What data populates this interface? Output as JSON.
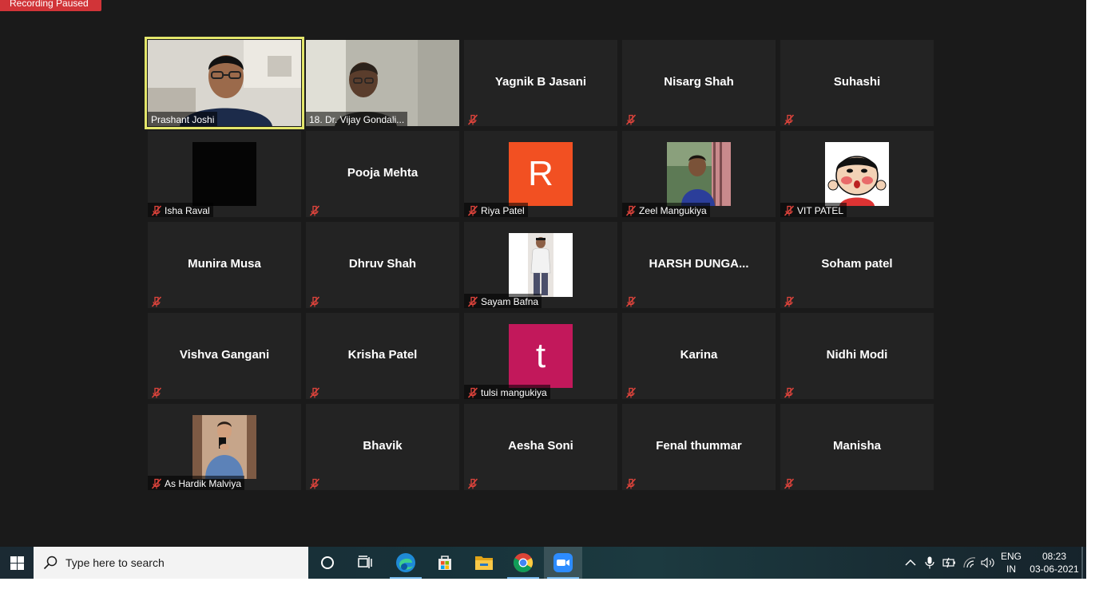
{
  "recording": {
    "label": "Recording Paused"
  },
  "participants": [
    {
      "name": "Prashant Joshi",
      "kind": "video",
      "active": true,
      "muted": false,
      "display": ""
    },
    {
      "name": "18. Dr. Vijay Gondali...",
      "kind": "video",
      "active": false,
      "muted": false,
      "display": ""
    },
    {
      "name": "Yagnik B Jasani",
      "kind": "name",
      "muted": true
    },
    {
      "name": "Nisarg Shah",
      "kind": "name",
      "muted": true
    },
    {
      "name": "Suhashi",
      "kind": "name",
      "muted": true
    },
    {
      "name": "Isha Raval",
      "kind": "avatar",
      "avatar": "black",
      "muted": true
    },
    {
      "name": "Pooja Mehta",
      "kind": "name",
      "muted": true
    },
    {
      "name": "Riya Patel",
      "kind": "letter",
      "letter": "R",
      "color": "#f25022",
      "muted": true
    },
    {
      "name": "Zeel Mangukiya",
      "kind": "avatar",
      "avatar": "photo-person",
      "muted": true
    },
    {
      "name": "VIT PATEL",
      "kind": "avatar",
      "avatar": "cartoon",
      "muted": true
    },
    {
      "name": "Munira Musa",
      "kind": "name",
      "muted": true
    },
    {
      "name": "Dhruv Shah",
      "kind": "name",
      "muted": true
    },
    {
      "name": "Sayam Bafna",
      "kind": "avatar",
      "avatar": "photo-standing",
      "muted": true
    },
    {
      "name": "HARSH  DUNGA...",
      "kind": "name",
      "muted": true
    },
    {
      "name": "Soham patel",
      "kind": "name",
      "muted": true
    },
    {
      "name": "Vishva Gangani",
      "kind": "name",
      "muted": true
    },
    {
      "name": "Krisha Patel",
      "kind": "name",
      "muted": true
    },
    {
      "name": "tulsi mangukiya",
      "kind": "letter",
      "letter": "t",
      "color": "#c2185b",
      "muted": true
    },
    {
      "name": "Karina",
      "kind": "name",
      "muted": true
    },
    {
      "name": "Nidhi Modi",
      "kind": "name",
      "muted": true
    },
    {
      "name": "As Hardik Malviya",
      "kind": "avatar",
      "avatar": "photo-selfie",
      "muted": true
    },
    {
      "name": "Bhavik",
      "kind": "name",
      "muted": true
    },
    {
      "name": "Aesha Soni",
      "kind": "name",
      "muted": true
    },
    {
      "name": "Fenal thummar",
      "kind": "name",
      "muted": true
    },
    {
      "name": "Manisha",
      "kind": "name",
      "muted": true
    }
  ],
  "taskbar": {
    "search_placeholder": "Type here to search",
    "apps": [
      {
        "name": "cortana-icon"
      },
      {
        "name": "task-view-icon"
      },
      {
        "name": "edge-icon",
        "running": true
      },
      {
        "name": "store-icon"
      },
      {
        "name": "file-explorer-icon"
      },
      {
        "name": "chrome-icon",
        "running": true
      },
      {
        "name": "zoom-icon",
        "running": true,
        "active": true
      }
    ],
    "lang_top": "ENG",
    "lang_bottom": "IN",
    "time": "08:23",
    "date": "03-06-2021"
  }
}
